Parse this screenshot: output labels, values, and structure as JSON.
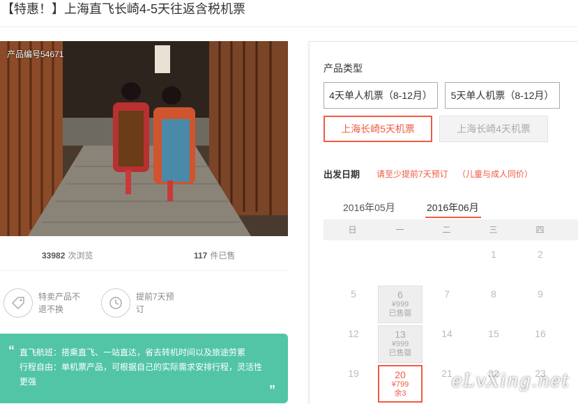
{
  "header": {
    "title": "【特惠！】上海直飞长崎4-5天往返含税机票"
  },
  "product": {
    "number_label": "产品编号54671"
  },
  "stats": {
    "views_num": "33982",
    "views_label": "次浏览",
    "sold_num": "117",
    "sold_label": "件已售"
  },
  "features": [
    {
      "line1": "特卖产品不",
      "line2": "退不换",
      "icon": "tag-icon"
    },
    {
      "line1": "提前7天预",
      "line2": "订",
      "icon": "clock-icon"
    }
  ],
  "promo": {
    "line1": "直飞航班：搭乘直飞、一站直达，省去转机时间以及旅途劳累",
    "line2": "行程自由：单机票产品，可根据自己的实际需求安排行程，灵活性",
    "line3": "更强",
    "open_quote": "“",
    "close_quote": "”"
  },
  "product_type": {
    "label": "产品类型",
    "options": [
      "4天单人机票（8-12月）",
      "5天单人机票（8-12月）",
      "上海长崎5天机票",
      "上海长崎4天机票"
    ]
  },
  "departure": {
    "label": "出发日期",
    "tip1": "请至少提前7天预订",
    "tip2": "（儿童与成人同价）"
  },
  "months": [
    "2016年05月",
    "2016年06月"
  ],
  "weekdays": [
    "日",
    "一",
    "二",
    "三",
    "四"
  ],
  "days": [
    {
      "n": "1"
    },
    {
      "n": "2"
    },
    {
      "n": "5"
    },
    {
      "n": "6",
      "price": "¥999",
      "status": "已售罄"
    },
    {
      "n": "7"
    },
    {
      "n": "8"
    },
    {
      "n": "9"
    },
    {
      "n": "12"
    },
    {
      "n": "13",
      "price": "¥999",
      "status": "已售罄"
    },
    {
      "n": "14"
    },
    {
      "n": "15"
    },
    {
      "n": "16"
    },
    {
      "n": "19"
    },
    {
      "n": "20",
      "price": "¥799",
      "status": "余3"
    },
    {
      "n": "21"
    },
    {
      "n": "22"
    },
    {
      "n": "23"
    }
  ],
  "watermark": "eLvXing.net",
  "colors": {
    "accent": "#f05a42",
    "green": "#52c5a6"
  }
}
